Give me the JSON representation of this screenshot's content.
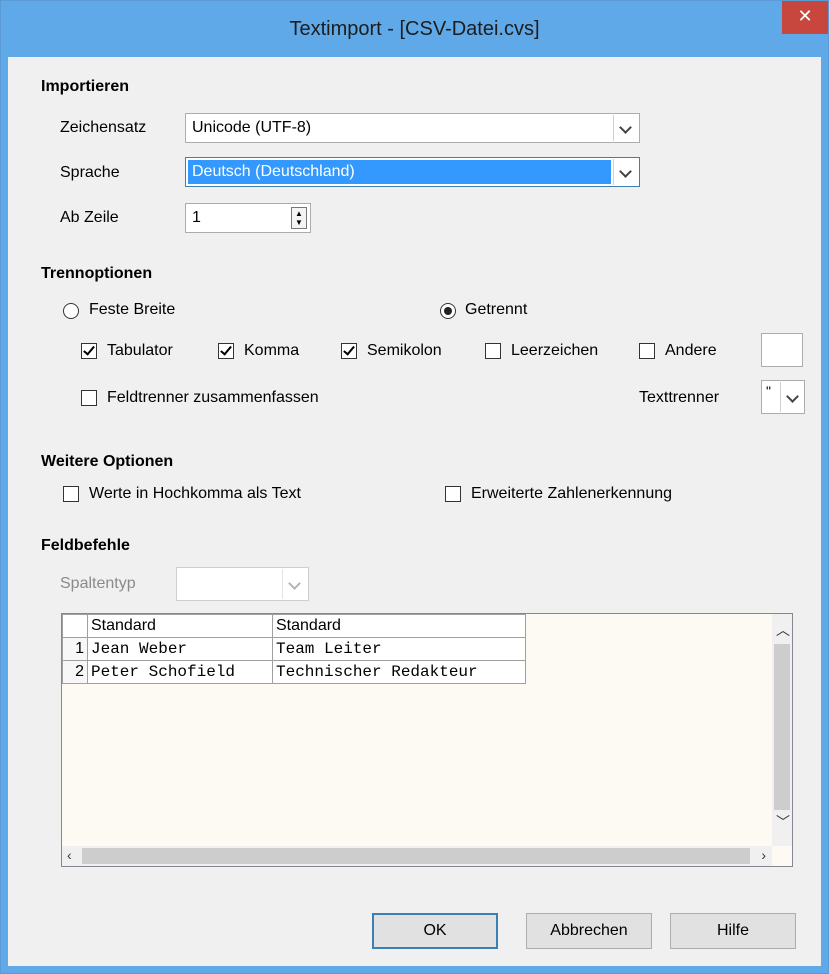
{
  "window": {
    "title": "Textimport - [CSV-Datei.cvs]",
    "close_icon": "close-icon"
  },
  "importieren": {
    "heading": "Importieren",
    "zeichensatz_label": "Zeichensatz",
    "zeichensatz_value": "Unicode (UTF-8)",
    "sprache_label": "Sprache",
    "sprache_value": "Deutsch (Deutschland)",
    "ab_zeile_label": "Ab Zeile",
    "ab_zeile_value": "1"
  },
  "trennoptionen": {
    "heading": "Trennoptionen",
    "feste_breite": "Feste Breite",
    "getrennt": "Getrennt",
    "tabulator": "Tabulator",
    "komma": "Komma",
    "semikolon": "Semikolon",
    "leerzeichen": "Leerzeichen",
    "andere": "Andere",
    "andere_value": "",
    "feldtrenner": "Feldtrenner zusammenfassen",
    "texttrenner_label": "Texttrenner",
    "texttrenner_value": "\""
  },
  "weitere": {
    "heading": "Weitere Optionen",
    "hochkomma": "Werte in Hochkomma als Text",
    "zahlenerkennung": "Erweiterte Zahlenerkennung"
  },
  "feldbefehle": {
    "heading": "Feldbefehle",
    "spaltentyp_label": "Spaltentyp",
    "spaltentyp_value": ""
  },
  "preview": {
    "headers": [
      "Standard",
      "Standard"
    ],
    "rows": [
      {
        "num": "1",
        "cells": [
          "Jean Weber",
          "Team Leiter"
        ]
      },
      {
        "num": "2",
        "cells": [
          "Peter Schofield",
          "Technischer Redakteur"
        ]
      }
    ]
  },
  "buttons": {
    "ok": "OK",
    "abbrechen": "Abbrechen",
    "hilfe": "Hilfe"
  },
  "colors": {
    "titlebar": "#5fa9e8",
    "close": "#c7463d",
    "selection": "#3399ff"
  }
}
